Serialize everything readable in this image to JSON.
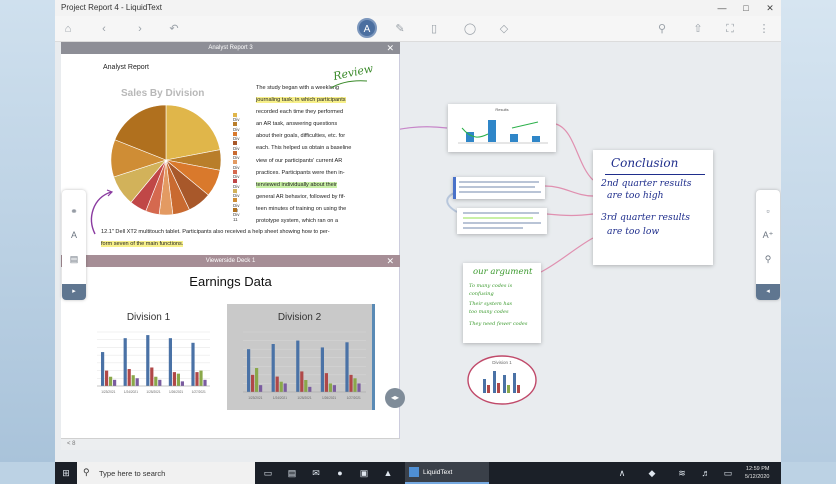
{
  "app": {
    "window_title": "Project Report 4 - LiquidText"
  },
  "document_pane": {
    "tab1_title": "Analyst Report 3",
    "tab2_title": "Viewerside Deck 1",
    "report_heading": "Analyst Report",
    "pie_title": "Sales By Division",
    "body_lines": [
      "The study began with a weeklong",
      "journaling task, in which participants",
      "recorded each time they performed",
      "an AR task, answering questions",
      "about their goals, difficulties, etc. for",
      "each. This helped us obtain a baseline",
      "view of our participants' current AR",
      "practices. Participants were then in-",
      "terviewed individually about their",
      "general AR behavior, followed by fif-",
      "teen minutes of training on using the",
      "prototype system, which ran on a"
    ],
    "caption_line1": "12.1\" Dell XT2 multitouch tablet. Participants also received a help sheet showing how to per-",
    "caption_line2": "form seven of the main functions.",
    "review_annotation": "Review",
    "earnings_title": "Earnings Data",
    "division1_title": "Division 1",
    "division2_title": "Division 2",
    "footer_page": "< 8"
  },
  "chart_data": [
    {
      "type": "pie",
      "title": "Sales By Division",
      "categories": [
        "Div 1",
        "Div 2",
        "Div 3",
        "Div 4",
        "Div 5",
        "Div 6",
        "Div 7",
        "Div 8",
        "Div 9",
        "Div 10",
        "Div 11"
      ],
      "values": [
        22,
        6,
        8,
        7,
        5,
        4,
        4,
        5,
        9,
        11,
        19
      ],
      "colors": [
        "#e0b64a",
        "#b97e2a",
        "#d9792c",
        "#a8582a",
        "#c96a30",
        "#e39a62",
        "#d5694f",
        "#c04747",
        "#d2b25a",
        "#cf8d35",
        "#b0701e"
      ],
      "legend_position": "right"
    },
    {
      "type": "bar",
      "title": "Division 1",
      "categories": [
        "1/23/2021",
        "1/24/2021",
        "1/25/2021",
        "1/26/2021",
        "1/27/2021"
      ],
      "series": [
        {
          "values": [
            22,
            31,
            33,
            31,
            28
          ],
          "color": "#4a72a6"
        },
        {
          "values": [
            10,
            11,
            12,
            9,
            9
          ],
          "color": "#b04848"
        },
        {
          "values": [
            6,
            7,
            6,
            8,
            10
          ],
          "color": "#8aa84a"
        },
        {
          "values": [
            4,
            5,
            4,
            3,
            4
          ],
          "color": "#7a5ca0"
        }
      ],
      "ylim": [
        0,
        35
      ]
    },
    {
      "type": "bar",
      "title": "Division 2",
      "categories": [
        "1/23/2021",
        "1/24/2021",
        "1/25/2021",
        "1/26/2021",
        "1/27/2021"
      ],
      "series": [
        {
          "values": [
            25,
            28,
            30,
            26,
            29
          ],
          "color": "#4a72a6"
        },
        {
          "values": [
            10,
            9,
            12,
            11,
            10
          ],
          "color": "#b04848"
        },
        {
          "values": [
            14,
            6,
            7,
            5,
            8
          ],
          "color": "#8aa84a"
        },
        {
          "values": [
            4,
            5,
            3,
            4,
            5
          ],
          "color": "#7a5ca0"
        }
      ],
      "ylim": [
        0,
        35
      ]
    }
  ],
  "workspace": {
    "conclusion_title": "Conclusion",
    "conclusion_lines": [
      "2nd quarter results",
      "are too high",
      "3rd quarter results",
      "are too low"
    ],
    "argument_title": "our argument",
    "argument_items": [
      "To many codes is",
      "confusing",
      "Their system has",
      "too many codes",
      "They need fewer codes"
    ],
    "excerpt_chart_title": "Results",
    "excerpt_division_label": "Division 1"
  },
  "taskbar": {
    "search_placeholder": "Type here to search",
    "active_app": "LiquidText",
    "time": "12:59 PM",
    "date": "5/12/2020"
  }
}
